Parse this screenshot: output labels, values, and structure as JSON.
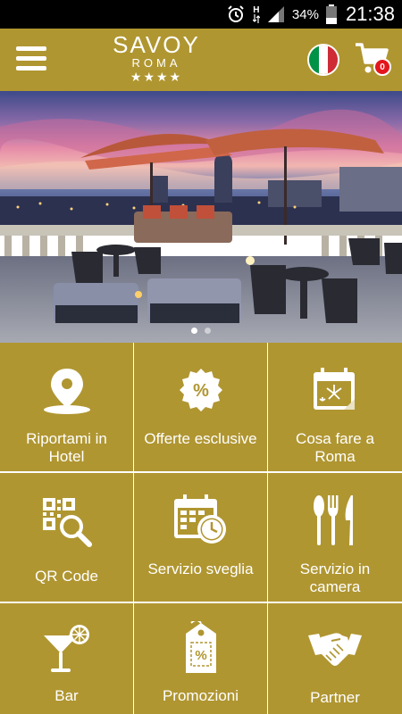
{
  "status_bar": {
    "battery_percent": "34%",
    "time": "21:38",
    "network_label": "H",
    "icons": [
      "alarm-icon",
      "network-h-icon",
      "signal-icon",
      "battery-icon"
    ]
  },
  "header": {
    "logo": {
      "name": "SAVOY",
      "city": "ROMA",
      "stars": "★★★★"
    },
    "menu_icon": "hamburger-menu-icon",
    "language_icon": "italy-flag-icon",
    "cart": {
      "icon": "shopping-cart-icon",
      "count": "0"
    }
  },
  "colors": {
    "brand": "#b09631",
    "badge": "#e4151c",
    "tile_text": "#ffffff"
  },
  "carousel": {
    "slide_count": 2,
    "active_index": 0,
    "image": "rooftop terrace with umbrellas over Rome at dusk"
  },
  "tiles": [
    {
      "label": "Riportami in Hotel",
      "icon": "map-pin-icon"
    },
    {
      "label": "Offerte esclusive",
      "icon": "percent-badge-icon"
    },
    {
      "label": "Cosa fare a Roma",
      "icon": "calendar-fireworks-icon"
    },
    {
      "label": "QR Code",
      "icon": "qr-search-icon"
    },
    {
      "label": "Servizio sveglia",
      "icon": "calendar-clock-icon"
    },
    {
      "label": "Servizio in camera",
      "icon": "cutlery-icon"
    },
    {
      "label": "Bar",
      "icon": "cocktail-icon"
    },
    {
      "label": "Promozioni",
      "icon": "price-tag-icon"
    },
    {
      "label": "Partner",
      "icon": "handshake-icon"
    }
  ]
}
